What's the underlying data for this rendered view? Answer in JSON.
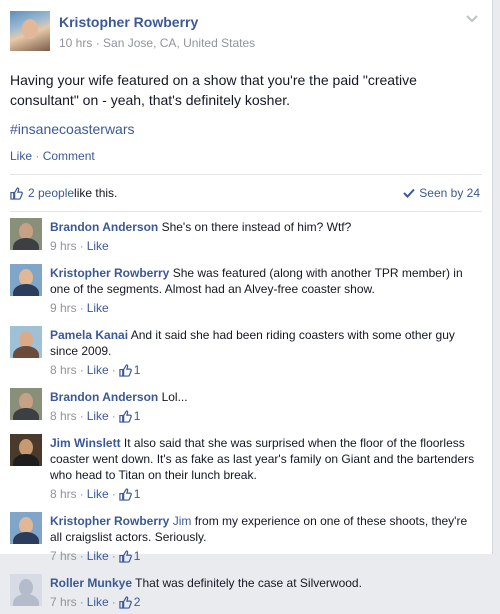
{
  "post": {
    "author": "Kristopher Rowberry",
    "time": "10 hrs",
    "location": "San Jose, CA, United States",
    "text": "Having your wife featured on a show that you're the paid \"creative consultant\" on - yeah, that's definitely kosher.",
    "hashtag": "#insanecoasterwars",
    "like_label": "Like",
    "comment_label": "Comment",
    "separator": "·"
  },
  "likes_bar": {
    "people": "2 people",
    "suffix": " like this.",
    "seen": "Seen by 24"
  },
  "comments": [
    {
      "name": "Brandon Anderson",
      "mention": "",
      "text": " She's on there instead of him? Wtf?",
      "time": "9 hrs",
      "like": "Like",
      "likes": "",
      "avatar": "brandon-anderson"
    },
    {
      "name": "Kristopher Rowberry",
      "mention": "",
      "text": " She was featured (along with another TPR member) in one of the segments. Almost had an Alvey-free coaster show.",
      "time": "9 hrs",
      "like": "Like",
      "likes": "",
      "avatar": "kristopher-rowberry"
    },
    {
      "name": "Pamela Kanai",
      "mention": "",
      "text": " And it said she had been riding coasters with some other guy since 2009.",
      "time": "8 hrs",
      "like": "Like",
      "likes": "1",
      "avatar": "pamela-kanai"
    },
    {
      "name": "Brandon Anderson",
      "mention": "",
      "text": " Lol...",
      "time": "8 hrs",
      "like": "Like",
      "likes": "1",
      "avatar": "brandon-anderson"
    },
    {
      "name": "Jim Winslett",
      "mention": "",
      "text": " It also said that she was surprised when the floor of the floorless coaster went down. It's as fake as last year's family on Giant and the bartenders who head to Titan on their lunch break.",
      "time": "8 hrs",
      "like": "Like",
      "likes": "1",
      "avatar": "jim-winslett"
    },
    {
      "name": "Kristopher Rowberry",
      "mention": "Jim",
      "text": " from my experience on one of these shoots, they're all craigslist actors. Seriously.",
      "time": "7 hrs",
      "like": "Like",
      "likes": "1",
      "avatar": "kristopher-rowberry"
    },
    {
      "name": "Roller Munkye",
      "mention": "",
      "text": " That was definitely the case at Silverwood.",
      "time": "7 hrs",
      "like": "Like",
      "likes": "2",
      "avatar": "roller-munkye"
    }
  ],
  "colors": {
    "link": "#3b5998",
    "meta": "#90949c",
    "text": "#141823",
    "background": "#e9ebee"
  },
  "icons": {
    "menu": "chevron-down-icon",
    "like": "thumbs-up-icon",
    "seen": "checkmark-icon"
  }
}
